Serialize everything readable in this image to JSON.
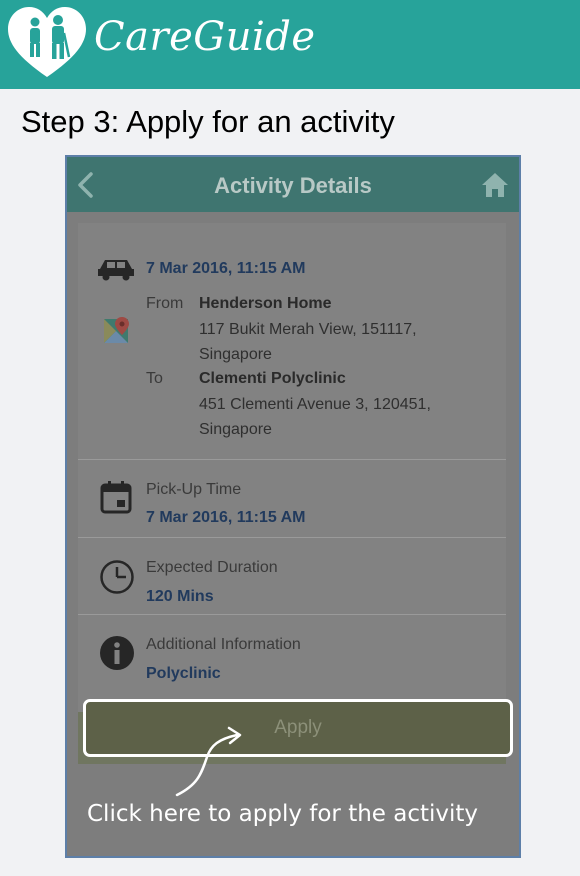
{
  "brand": {
    "name": "CareGuide",
    "logo_icon": "heart-family-icon"
  },
  "page": {
    "step_title": "Step 3: Apply for an activity"
  },
  "appbar": {
    "title": "Activity Details",
    "back_icon": "back-chevron-icon",
    "home_icon": "home-icon"
  },
  "trip": {
    "datetime": "7 Mar 2016, 11:15 AM",
    "from_label": "From",
    "from_name": "Henderson Home",
    "from_address_line1": "117 Bukit Merah View, 151117,",
    "from_address_line2": "Singapore",
    "to_label": "To",
    "to_name": "Clementi Polyclinic",
    "to_address_line1": "451 Clementi Avenue 3, 120451,",
    "to_address_line2": "Singapore"
  },
  "pickup": {
    "label": "Pick-Up Time",
    "value": "7 Mar 2016, 11:15 AM"
  },
  "duration": {
    "label": "Expected Duration",
    "value": "120 Mins"
  },
  "info": {
    "label": "Additional Information",
    "value": "Polyclinic"
  },
  "apply": {
    "label": "Apply"
  },
  "hint": {
    "text": "Click here to apply for the activity"
  },
  "colors": {
    "brand_teal": "#27a39a",
    "appbar": "#3f7570",
    "overlay": "#7d7d7d",
    "date_text": "#213a5d"
  }
}
